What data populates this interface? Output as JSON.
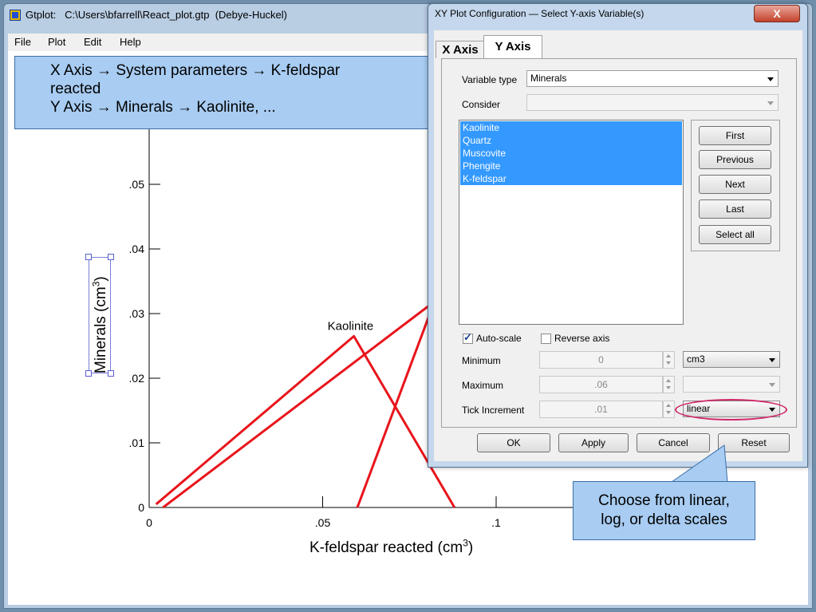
{
  "main_window": {
    "title": "Gtplot:   C:\\Users\\bfarrell\\React_plot.gtp  (Debye-Huckel)",
    "menu": [
      "File",
      "Plot",
      "Edit",
      "Help"
    ]
  },
  "callout_top": {
    "line1": "X Axis → System parameters → K-feldspar",
    "line2": "reacted",
    "line3": "Y Axis → Minerals → Kaolinite, ..."
  },
  "callout_bottom": {
    "line1": "Choose from linear,",
    "line2": "log, or delta scales"
  },
  "dialog": {
    "title": "XY Plot Configuration — Select Y-axis Variable(s)",
    "close_label": "X",
    "tabs": [
      "X Axis",
      "Y Axis"
    ],
    "active_tab": "Y Axis",
    "variable_type_label": "Variable type",
    "variable_type_value": "Minerals",
    "consider_label": "Consider",
    "consider_value": "",
    "variables": [
      "Kaolinite",
      "Quartz",
      "Muscovite",
      "Phengite",
      "K-feldspar"
    ],
    "nav_buttons": [
      "First",
      "Previous",
      "Next",
      "Last",
      "Select all"
    ],
    "autoscale_label": "Auto-scale",
    "autoscale_checked": true,
    "reverse_label": "Reverse axis",
    "reverse_checked": false,
    "minimum_label": "Minimum",
    "minimum_value": "0",
    "maximum_label": "Maximum",
    "maximum_value": ".06",
    "tick_label": "Tick Increment",
    "tick_value": ".01",
    "units_value": "cm3",
    "max_units_value": "",
    "scale_value": "linear",
    "buttons": [
      "OK",
      "Apply",
      "Cancel",
      "Reset"
    ]
  },
  "chart_data": {
    "type": "line",
    "xlabel": "K-feldspar reacted (cm3)",
    "ylabel": "Minerals (cm3)",
    "x_ticks": [
      "0",
      ".05",
      ".1"
    ],
    "y_ticks": [
      "0",
      ".01",
      ".02",
      ".03",
      ".04",
      ".05"
    ],
    "xlim": [
      0,
      0.15
    ],
    "ylim": [
      0,
      0.06
    ],
    "annotations": [
      "Kaolinite"
    ],
    "series": [
      {
        "name": "Kaolinite",
        "x": [
          0.002,
          0.059,
          0.088
        ],
        "y": [
          0.0005,
          0.0265,
          0.0
        ]
      },
      {
        "x": [
          0.004,
          0.085
        ],
        "y": [
          0.0,
          0.033
        ]
      },
      {
        "x": [
          0.06,
          0.083
        ],
        "y": [
          0.0,
          0.033
        ]
      }
    ],
    "line_color": "#e8141b"
  }
}
